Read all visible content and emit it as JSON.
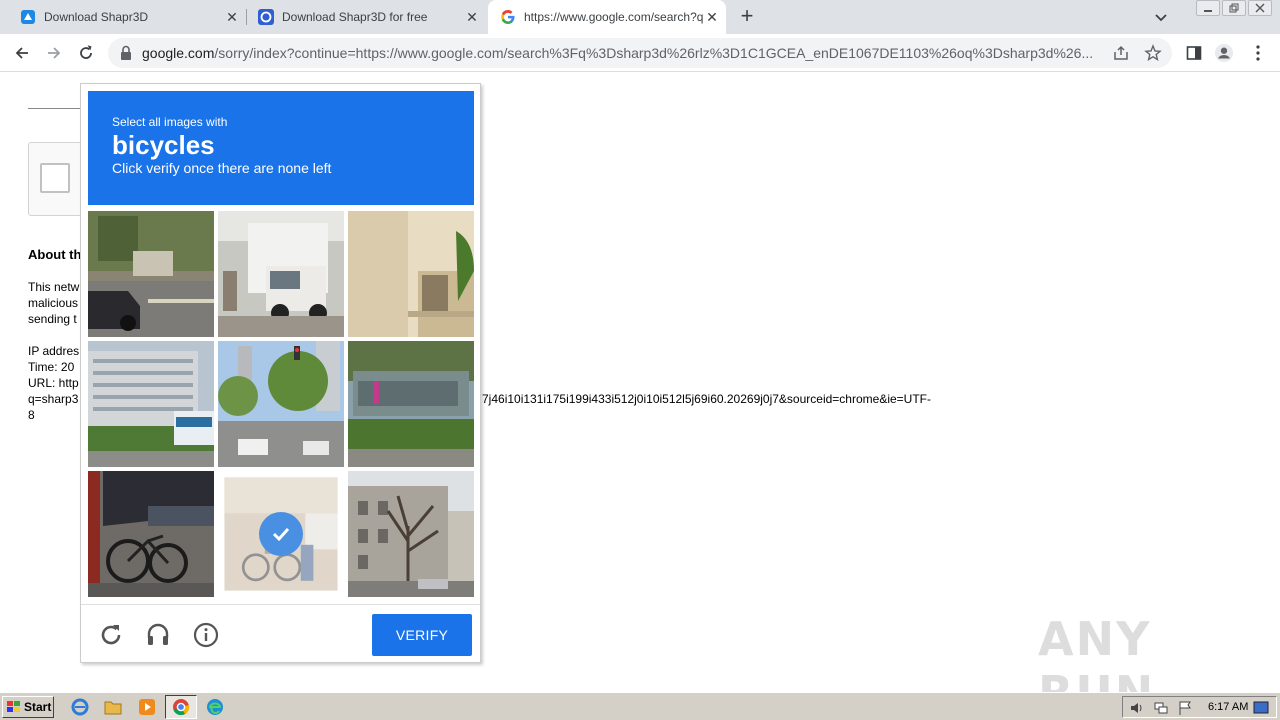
{
  "tabs": [
    {
      "title": "Download Shapr3D",
      "favicon": "shapr3d-icon"
    },
    {
      "title": "Download Shapr3D for free",
      "favicon": "download-site-icon"
    },
    {
      "title": "https://www.google.com/search?q=",
      "favicon": "google-icon",
      "active": true
    }
  ],
  "address_bar": {
    "host": "google.com",
    "rest": "/sorry/index?continue=https://www.google.com/search%3Fq%3Dsharp3d%26rlz%3D1C1GCEA_enDE1067DE1103%26oq%3Dsharp3d%26..."
  },
  "background_page": {
    "heading": "About th",
    "para1": [
      "This netw",
      "malicious",
      "sending t"
    ],
    "info": [
      "IP addres",
      "Time: 20",
      "URL: http",
      "q=sharp3",
      "8"
    ],
    "url_tail": "7j46i10i131i175i199i433i512j0i10i512l5j69i60.20269j0j7&sourceid=chrome&ie=UTF-"
  },
  "captcha": {
    "line1": "Select all images with",
    "target": "bicycles",
    "line3": "Click verify once there are none left",
    "verify_label": "VERIFY",
    "accent": "#1a73e8",
    "tiles": [
      {
        "subject": "street-with-car",
        "selected": false
      },
      {
        "subject": "white-truck",
        "selected": false
      },
      {
        "subject": "building-balcony",
        "selected": false
      },
      {
        "subject": "apartment-bus",
        "selected": false
      },
      {
        "subject": "city-intersection",
        "selected": false
      },
      {
        "subject": "shop-front-trees",
        "selected": false
      },
      {
        "subject": "parked-bicycle",
        "selected": false
      },
      {
        "subject": "cyclist-street",
        "selected": true
      },
      {
        "subject": "bare-tree-building",
        "selected": false
      }
    ]
  },
  "watermark": "ANY RUN",
  "taskbar": {
    "start_label": "Start",
    "clock": "6:17 AM"
  }
}
